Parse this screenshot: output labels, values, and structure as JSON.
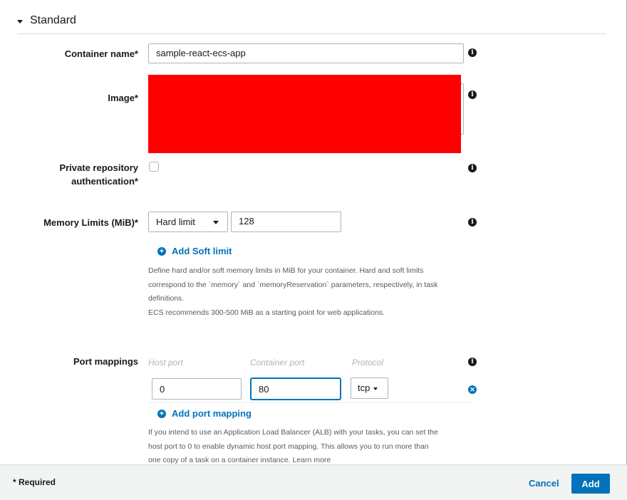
{
  "section": {
    "title": "Standard"
  },
  "container_name": {
    "label": "Container name*",
    "value": "sample-react-ecs-app"
  },
  "image": {
    "label": "Image*"
  },
  "private_repo": {
    "label_line1": "Private repository",
    "label_line2": "authentication*",
    "checked": false
  },
  "memory": {
    "label": "Memory Limits (MiB)*",
    "limit_type": "Hard limit",
    "value": "128",
    "add_soft_limit": "Add Soft limit",
    "help_lines": [
      "Define hard and/or soft memory limits in MiB for your container. Hard and soft limits",
      "correspond to the `memory` and `memoryReservation` parameters, respectively, in task",
      "definitions.",
      "ECS recommends 300-500 MiB as a starting point for web applications."
    ]
  },
  "port_mappings": {
    "label": "Port mappings",
    "col_host": "Host port",
    "col_container": "Container port",
    "col_protocol": "Protocol",
    "row": {
      "host_port": "0",
      "container_port": "80",
      "protocol": "tcp"
    },
    "add_link": "Add port mapping",
    "help_lines": [
      "If you intend to use an Application Load Balancer (ALB) with your tasks, you can set the",
      "host port to 0 to enable dynamic host port mapping. This allows you to run more than",
      "one copy of a task on a container instance. Learn more"
    ]
  },
  "footer": {
    "required_note": "* Required",
    "cancel": "Cancel",
    "add": "Add"
  },
  "icons": {
    "info": "info-icon",
    "plus": "plus-circle-icon",
    "remove": "remove-circle-icon",
    "caret": "caret-down-icon"
  },
  "colors": {
    "link": "#0073bb",
    "primary_button": "#0073bb",
    "footer_bg": "#f2f3f3",
    "redaction": "#ff0000"
  }
}
